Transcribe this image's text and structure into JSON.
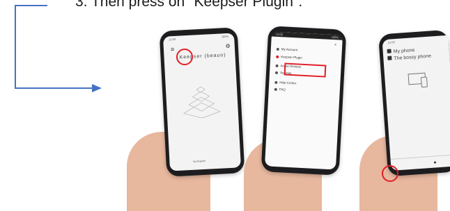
{
  "instruction": "3. Then press on \"Keepser Plugin\".",
  "colors": {
    "arrow": "#4472c4",
    "highlight": "#e11d25"
  },
  "phone1": {
    "app_title": "Keepser (beauo)",
    "footer": "by Keepser"
  },
  "phone2": {
    "menu": [
      "My Account",
      "Keepser Plugin",
      "Active Devices",
      "Settings",
      "Help Center",
      "FAQ"
    ]
  },
  "phone3": {
    "items": [
      "My phone",
      "The bossy phone"
    ]
  }
}
